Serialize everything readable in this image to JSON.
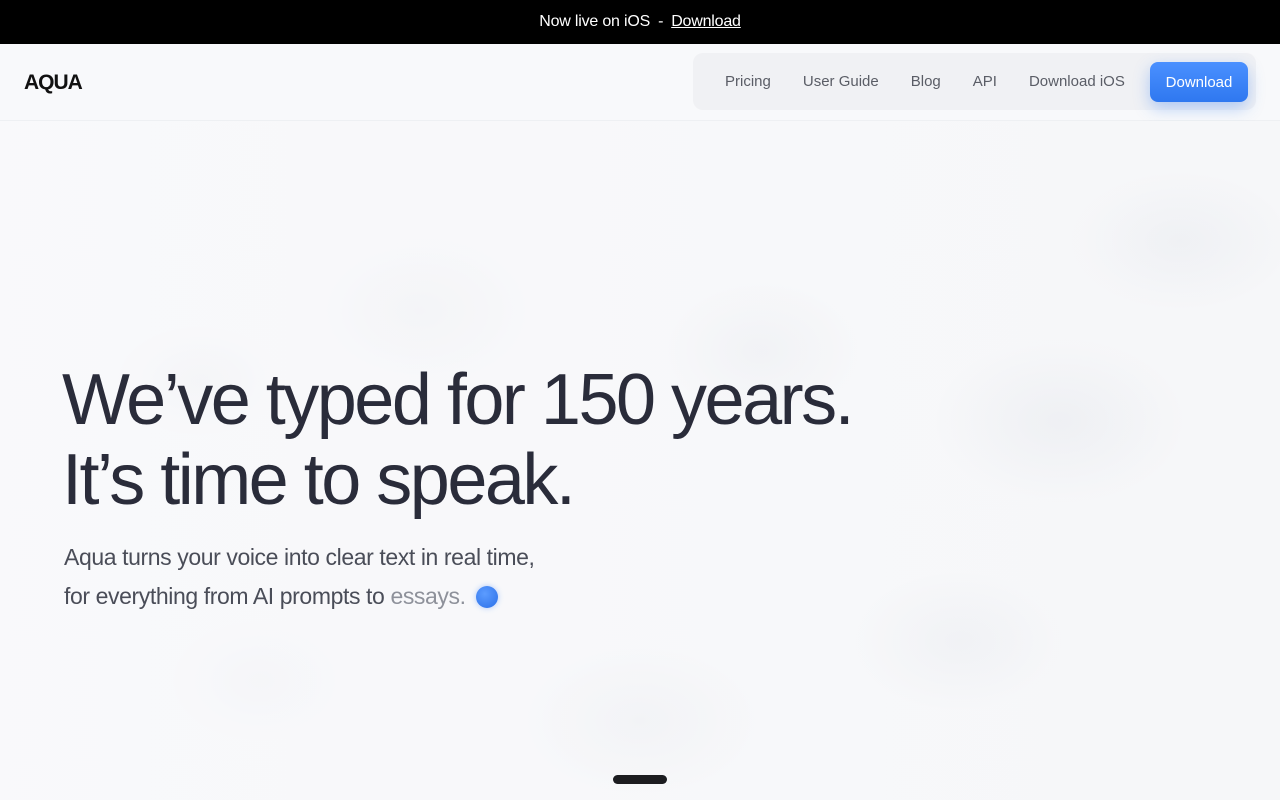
{
  "announcement": {
    "text": "Now live on iOS",
    "separator": "-",
    "link_label": "Download"
  },
  "header": {
    "logo": "AQUA",
    "nav": [
      {
        "label": "Pricing"
      },
      {
        "label": "User Guide"
      },
      {
        "label": "Blog"
      },
      {
        "label": "API"
      },
      {
        "label": "Download iOS"
      }
    ],
    "cta_label": "Download"
  },
  "hero": {
    "headline_line1": "We’ve typed for 150 years.",
    "headline_line2": "It’s time to speak.",
    "subtitle_line1": "Aqua turns your voice into clear text in real time,",
    "subtitle_line2_prefix": "for everything from AI prompts to",
    "subtitle_line2_typing": "essays.",
    "indicator_icon": "recording-dot-icon"
  },
  "colors": {
    "accent": "#3b82f6",
    "announcement_bg": "#000000",
    "headline": "#2a2c3a"
  }
}
